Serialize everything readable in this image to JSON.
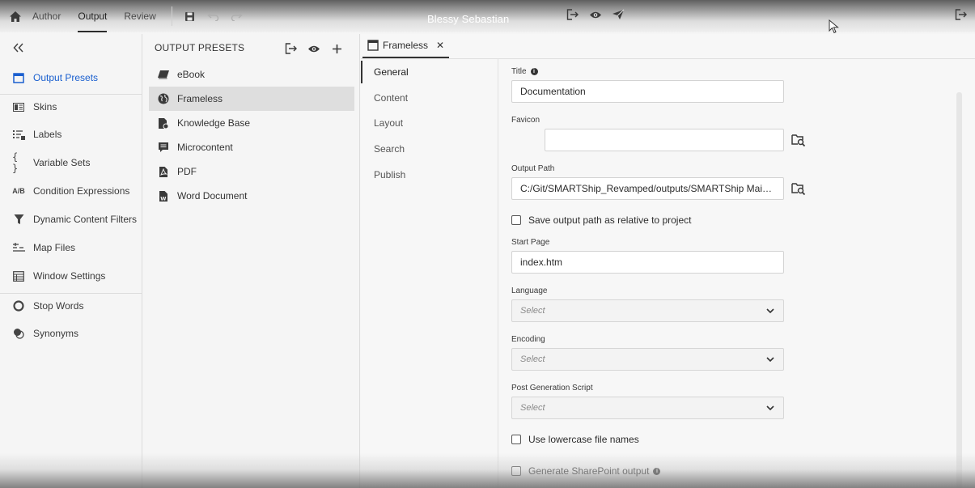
{
  "top_nav": {
    "tabs": [
      {
        "label": "Author",
        "active": false
      },
      {
        "label": "Output",
        "active": true
      },
      {
        "label": "Review",
        "active": false
      }
    ],
    "user_name": "Blessy Sebastian"
  },
  "sidebar": {
    "items": [
      {
        "label": "Output Presets",
        "icon": "output-presets-icon",
        "active": true
      },
      {
        "label": "Skins",
        "icon": "skins-icon"
      },
      {
        "label": "Labels",
        "icon": "labels-icon"
      },
      {
        "label": "Variable Sets",
        "icon": "variable-sets-icon",
        "glyph": "{ }"
      },
      {
        "label": "Condition Expressions",
        "icon": "condition-expressions-icon",
        "glyph": "A/B"
      },
      {
        "label": "Dynamic Content Filters",
        "icon": "filter-icon"
      },
      {
        "label": "Map Files",
        "icon": "map-files-icon"
      },
      {
        "label": "Window Settings",
        "icon": "window-settings-icon"
      },
      {
        "label": "Stop Words",
        "icon": "stop-words-icon"
      },
      {
        "label": "Synonyms",
        "icon": "synonyms-icon"
      }
    ]
  },
  "presets": {
    "header": "OUTPUT PRESETS",
    "items": [
      {
        "label": "eBook",
        "icon": "ebook-icon"
      },
      {
        "label": "Frameless",
        "icon": "globe-icon",
        "selected": true
      },
      {
        "label": "Knowledge Base",
        "icon": "knowledge-base-icon"
      },
      {
        "label": "Microcontent",
        "icon": "microcontent-icon"
      },
      {
        "label": "PDF",
        "icon": "pdf-icon"
      },
      {
        "label": "Word Document",
        "icon": "word-document-icon"
      }
    ]
  },
  "editor": {
    "tab_label": "Frameless",
    "close_glyph": "✕",
    "sub_nav": [
      "General",
      "Content",
      "Layout",
      "Search",
      "Publish"
    ],
    "form": {
      "title_label": "Title",
      "title_value": "Documentation",
      "favicon_label": "Favicon",
      "favicon_value": "",
      "output_path_label": "Output Path",
      "output_path_value": "C:/Git/SMARTShip_Revamped/outputs/SMARTShip Main/Fra...",
      "save_relative_label": "Save output path as relative to project",
      "start_page_label": "Start Page",
      "start_page_value": "index.htm",
      "language_label": "Language",
      "language_value": "Select",
      "encoding_label": "Encoding",
      "encoding_value": "Select",
      "post_script_label": "Post Generation Script",
      "post_script_value": "Select",
      "lowercase_label": "Use lowercase file names",
      "sharepoint_label": "Generate SharePoint output"
    }
  },
  "colors": {
    "accent": "#1a5fcf",
    "selected_bg": "#dedede",
    "panel_bg": "#f5f5f5"
  }
}
